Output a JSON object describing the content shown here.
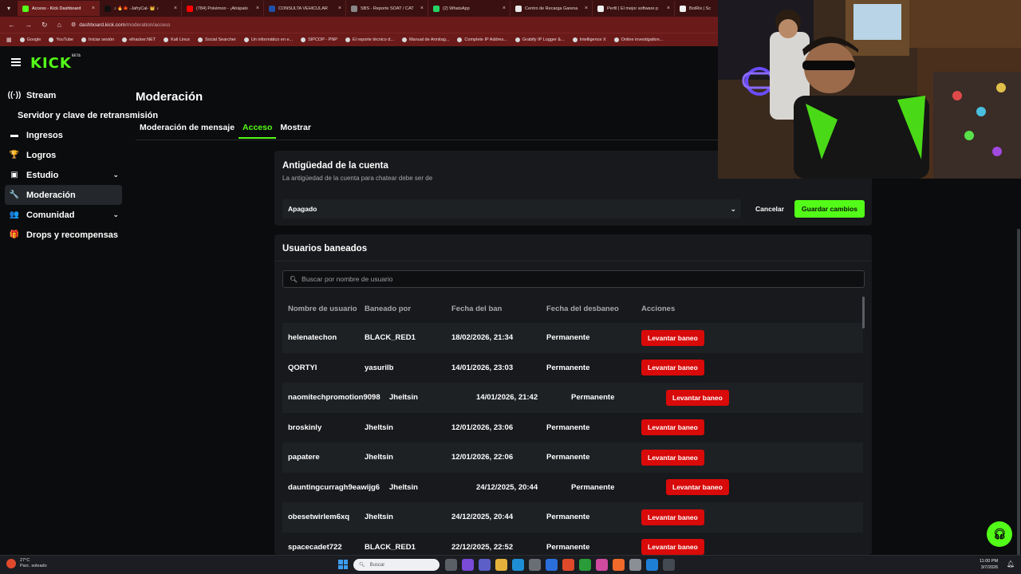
{
  "browser": {
    "tabs": [
      {
        "label": "Access - Kick Dashboard",
        "color": "#53fc18",
        "active": true
      },
      {
        "label": "♪ 🔥🍁 -JafryCal- 👑 ♪",
        "color": "#111111"
      },
      {
        "label": "(784) Pokémon - ¡Atrápalo",
        "color": "#ff0000"
      },
      {
        "label": "CONSULTA VEHICULAR",
        "color": "#1f4fa8"
      },
      {
        "label": "SBS - Reporte SOAT / CAT",
        "color": "#888888"
      },
      {
        "label": "(2) WhatsApp",
        "color": "#25d366"
      },
      {
        "label": "Centro de Recarga Garena",
        "color": "#e8e8e8"
      },
      {
        "label": "Perfil | El mejor software p",
        "color": "#f0f0f0"
      },
      {
        "label": "BotRix | Sc",
        "color": "#f0f0f0"
      }
    ],
    "url_host": "dashboard.kick.com",
    "url_path": "/moderation/access",
    "bookmarks": [
      "Google",
      "YouTube",
      "Iniciar sesión",
      "elhacker.NET",
      "Kali Linux",
      "Social Searcher",
      "Un informático en e...",
      "SIPCOP - PNP",
      "El reporte técnico d...",
      "Manual de Armitag...",
      "Complete IP Addres...",
      "Grabify IP Logger &...",
      "Intelligence X",
      "Online investigation..."
    ]
  },
  "kick": {
    "logo": "KICK",
    "logo_badge": "BETA",
    "sidebar": [
      {
        "label": "Stream",
        "icon": "radio-icon",
        "glyph": "((·))"
      },
      {
        "label": "Servidor y clave de retransmisión",
        "sub": true
      },
      {
        "label": "Ingresos",
        "icon": "wallet-icon",
        "glyph": "▬"
      },
      {
        "label": "Logros",
        "icon": "trophy-icon",
        "glyph": "🏆"
      },
      {
        "label": "Estudio",
        "icon": "studio-icon",
        "glyph": "▣",
        "chevron": true
      },
      {
        "label": "Moderación",
        "icon": "wrench-icon",
        "glyph": "🔧",
        "active": true
      },
      {
        "label": "Comunidad",
        "icon": "community-icon",
        "glyph": "👥",
        "chevron": true
      },
      {
        "label": "Drops y recompensas",
        "icon": "gift-icon",
        "glyph": "🎁"
      }
    ],
    "page_title": "Moderación",
    "tabs": [
      {
        "label": "Moderación de mensaje"
      },
      {
        "label": "Acceso",
        "active": true
      },
      {
        "label": "Mostrar"
      }
    ],
    "account_age": {
      "title": "Antigüedad de la cuenta",
      "subtitle": "La antigüedad de la cuenta para chatear debe ser de",
      "selected": "Apagado",
      "cancel": "Cancelar",
      "save": "Guardar cambios"
    },
    "banned": {
      "title": "Usuarios baneados",
      "search_placeholder": "Buscar por nombre de usuario",
      "columns": [
        "Nombre de usuario",
        "Baneado por",
        "Fecha del ban",
        "Fecha del desbaneo",
        "Acciones"
      ],
      "action_label": "Levantar baneo",
      "rows": [
        {
          "user": "helenatechon",
          "by": "BLACK_RED1",
          "ban": "18/02/2026, 21:34",
          "unban": "Permanente"
        },
        {
          "user": "QORTYI",
          "by": "yasurilb",
          "ban": "14/01/2026, 23:03",
          "unban": "Permanente"
        },
        {
          "user": "naomitechpromotion9098",
          "by": "Jheltsin",
          "ban": "14/01/2026, 21:42",
          "unban": "Permanente",
          "wide": true
        },
        {
          "user": "broskinly",
          "by": "Jheltsin",
          "ban": "12/01/2026, 23:06",
          "unban": "Permanente"
        },
        {
          "user": "papatere",
          "by": "Jheltsin",
          "ban": "12/01/2026, 22:06",
          "unban": "Permanente"
        },
        {
          "user": "dauntingcurragh9eawijg6",
          "by": "Jheltsin",
          "ban": "24/12/2025, 20:44",
          "unban": "Permanente",
          "wide": true
        },
        {
          "user": "obesetwirlem6xq",
          "by": "Jheltsin",
          "ban": "24/12/2025, 20:44",
          "unban": "Permanente"
        },
        {
          "user": "spacecadet722",
          "by": "BLACK_RED1",
          "ban": "22/12/2025, 22:52",
          "unban": "Permanente"
        }
      ]
    }
  },
  "taskbar": {
    "weather_temp": "27°C",
    "weather_desc": "Parc. soleado",
    "search_placeholder": "Buscar",
    "time": "11:00 PM",
    "date": "3/7/2026"
  },
  "colors": {
    "accent": "#53fc18",
    "danger": "#d90a0a",
    "chrome": "#6b1a1a"
  }
}
